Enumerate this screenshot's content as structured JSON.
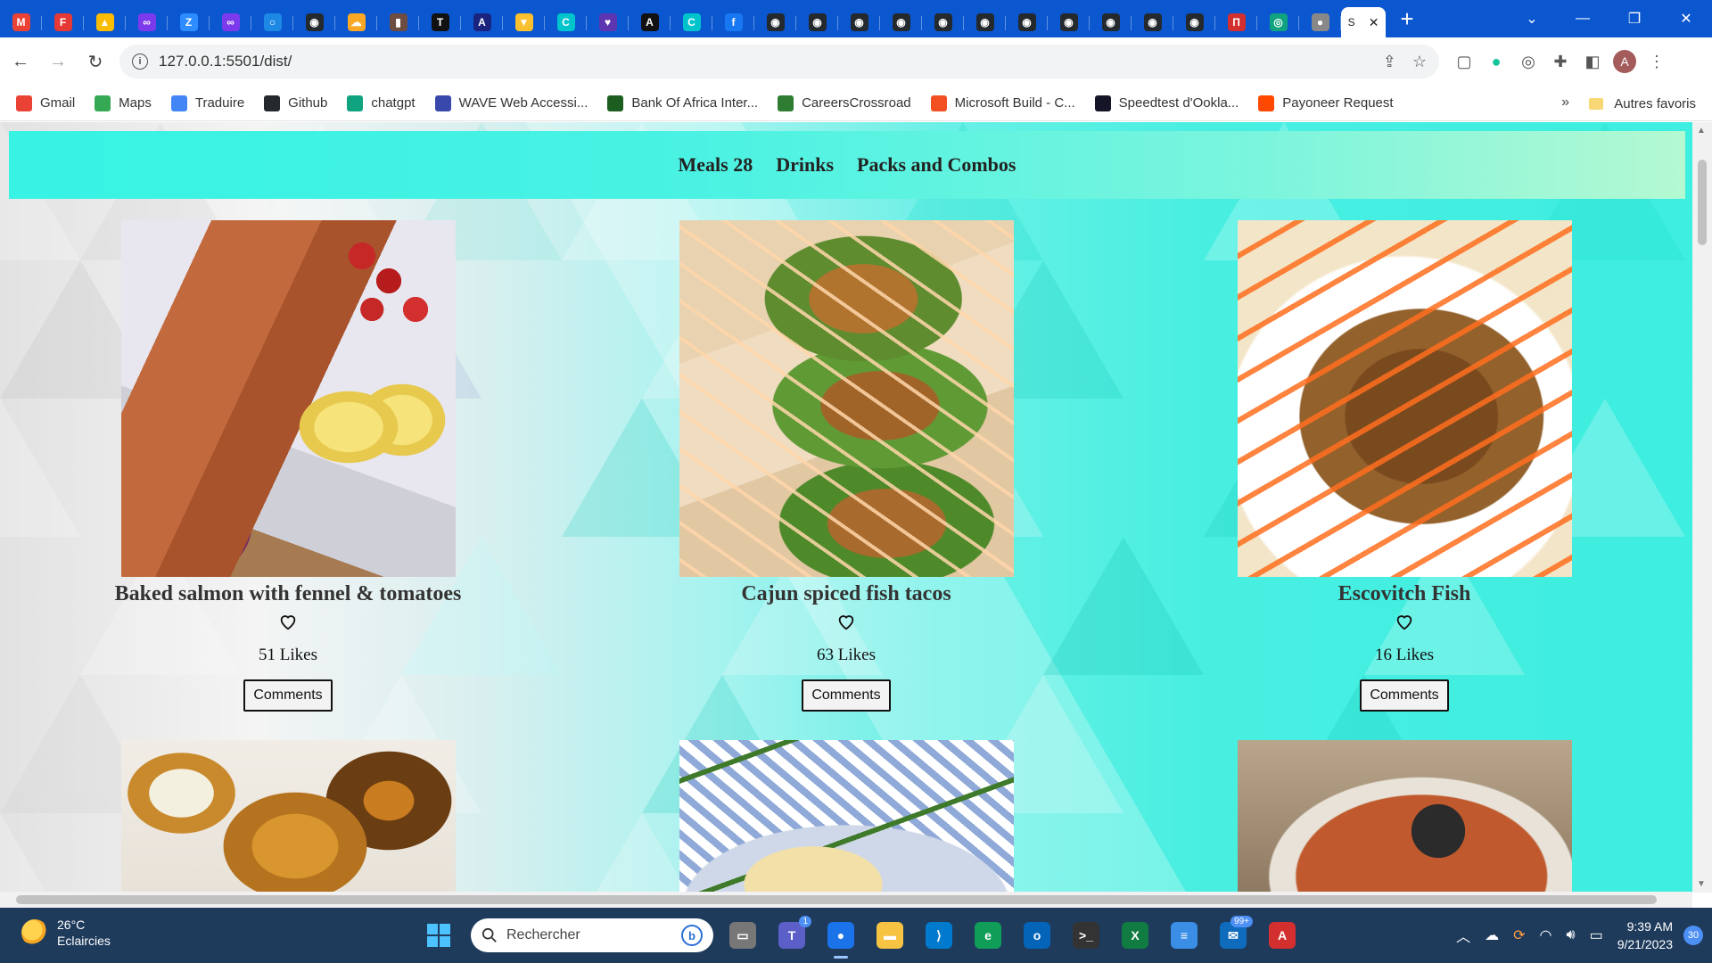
{
  "browser": {
    "tab_favicons": [
      {
        "icon": "gmail-icon",
        "color": "#ea4335",
        "glyph": "M"
      },
      {
        "icon": "app-icon",
        "color": "#e53935",
        "glyph": "F"
      },
      {
        "icon": "drive-icon",
        "color": "#fbbc04",
        "glyph": "▲"
      },
      {
        "icon": "app-icon",
        "color": "#7c3aed",
        "glyph": "∞"
      },
      {
        "icon": "zoom-icon",
        "color": "#2d8cff",
        "glyph": "Z"
      },
      {
        "icon": "app-icon",
        "color": "#7c3aed",
        "glyph": "∞"
      },
      {
        "icon": "app-icon",
        "color": "#1e88e5",
        "glyph": "○"
      },
      {
        "icon": "github-icon",
        "color": "#24292e",
        "glyph": "◉"
      },
      {
        "icon": "app-icon",
        "color": "#f9a825",
        "glyph": "☁"
      },
      {
        "icon": "app-icon",
        "color": "#6d4c41",
        "glyph": "▮"
      },
      {
        "icon": "app-icon",
        "color": "#111111",
        "glyph": "T"
      },
      {
        "icon": "app-icon",
        "color": "#1a237e",
        "glyph": "A"
      },
      {
        "icon": "app-icon",
        "color": "#fbc02d",
        "glyph": "▼"
      },
      {
        "icon": "canva-icon",
        "color": "#00c4cc",
        "glyph": "C"
      },
      {
        "icon": "app-icon",
        "color": "#5e35b1",
        "glyph": "♥"
      },
      {
        "icon": "app-icon",
        "color": "#111111",
        "glyph": "A"
      },
      {
        "icon": "canva-icon",
        "color": "#00c4cc",
        "glyph": "C"
      },
      {
        "icon": "facebook-icon",
        "color": "#1877f2",
        "glyph": "f"
      },
      {
        "icon": "github-icon",
        "color": "#24292e",
        "glyph": "◉"
      },
      {
        "icon": "github-icon",
        "color": "#24292e",
        "glyph": "◉"
      },
      {
        "icon": "github-icon",
        "color": "#24292e",
        "glyph": "◉"
      },
      {
        "icon": "github-icon",
        "color": "#24292e",
        "glyph": "◉"
      },
      {
        "icon": "github-icon",
        "color": "#24292e",
        "glyph": "◉"
      },
      {
        "icon": "github-icon",
        "color": "#24292e",
        "glyph": "◉"
      },
      {
        "icon": "github-icon",
        "color": "#24292e",
        "glyph": "◉"
      },
      {
        "icon": "github-icon",
        "color": "#24292e",
        "glyph": "◉"
      },
      {
        "icon": "github-icon",
        "color": "#24292e",
        "glyph": "◉"
      },
      {
        "icon": "github-icon",
        "color": "#24292e",
        "glyph": "◉"
      },
      {
        "icon": "github-icon",
        "color": "#24292e",
        "glyph": "◉"
      },
      {
        "icon": "app-icon",
        "color": "#d32f2f",
        "glyph": "П"
      },
      {
        "icon": "chatgpt-icon",
        "color": "#10a37f",
        "glyph": "◎"
      },
      {
        "icon": "app-icon",
        "color": "#888888",
        "glyph": "●"
      }
    ],
    "active_tab_title": "S",
    "url": "127.0.0.1:5501/dist/",
    "bookmarks": [
      {
        "label": "Gmail",
        "icon": "gmail-icon",
        "color": "#ea4335"
      },
      {
        "label": "Maps",
        "icon": "maps-icon",
        "color": "#34a853"
      },
      {
        "label": "Traduire",
        "icon": "translate-icon",
        "color": "#4285f4"
      },
      {
        "label": "Github",
        "icon": "github-icon",
        "color": "#24292e"
      },
      {
        "label": "chatgpt",
        "icon": "chatgpt-icon",
        "color": "#10a37f"
      },
      {
        "label": "WAVE Web Accessi...",
        "icon": "wave-icon",
        "color": "#3949ab"
      },
      {
        "label": "Bank Of Africa Inter...",
        "icon": "bank-icon",
        "color": "#1b5e20"
      },
      {
        "label": "CareersCrossroad",
        "icon": "careers-icon",
        "color": "#2e7d32"
      },
      {
        "label": "Microsoft Build - C...",
        "icon": "microsoft-icon",
        "color": "#f25022"
      },
      {
        "label": "Speedtest d'Ookla...",
        "icon": "speedtest-icon",
        "color": "#141526"
      },
      {
        "label": "Payoneer Request",
        "icon": "payoneer-icon",
        "color": "#ff4800"
      }
    ],
    "bookmarks_more": "»",
    "other_bookmarks": "Autres favoris",
    "avatar_letter": "A"
  },
  "page": {
    "nav": [
      {
        "label": "Meals 28"
      },
      {
        "label": "Drinks"
      },
      {
        "label": "Packs and Combos"
      }
    ],
    "meals": [
      {
        "title": "Baked salmon with fennel & tomatoes",
        "likes": "51 Likes",
        "comments": "Comments",
        "image": "salmon-photo"
      },
      {
        "title": "Cajun spiced fish tacos",
        "likes": "63 Likes",
        "comments": "Comments",
        "image": "tacos-photo"
      },
      {
        "title": "Escovitch Fish",
        "likes": "16 Likes",
        "comments": "Comments",
        "image": "fish-photo"
      }
    ],
    "next_row_images": [
      "croquettes-photo",
      "fishpie-photo",
      "seafood-soup-photo"
    ]
  },
  "taskbar": {
    "weather_temp": "26°C",
    "weather_desc": "Eclaircies",
    "search_placeholder": "Rechercher",
    "apps": [
      {
        "icon": "file-explorer-icon",
        "color": "#777777",
        "glyph": "▭"
      },
      {
        "icon": "teams-icon",
        "color": "#5b5fc7",
        "glyph": "T",
        "badge": "1"
      },
      {
        "icon": "chrome-icon",
        "color": "#1a73e8",
        "glyph": "●",
        "active": true
      },
      {
        "icon": "folder-icon",
        "color": "#f6c343",
        "glyph": "▬"
      },
      {
        "icon": "vscode-icon",
        "color": "#007acc",
        "glyph": "⟩"
      },
      {
        "icon": "edge-icon",
        "color": "#0f9d58",
        "glyph": "e"
      },
      {
        "icon": "outlook-icon",
        "color": "#0364b8",
        "glyph": "o"
      },
      {
        "icon": "terminal-icon",
        "color": "#333333",
        "glyph": ">_"
      },
      {
        "icon": "excel-icon",
        "color": "#107c41",
        "glyph": "X"
      },
      {
        "icon": "notepad-icon",
        "color": "#3a8ee6",
        "glyph": "≡"
      },
      {
        "icon": "mail-icon",
        "color": "#0f6cbd",
        "glyph": "✉",
        "badge": "99+"
      },
      {
        "icon": "acrobat-icon",
        "color": "#d32f2f",
        "glyph": "A"
      }
    ],
    "time": "9:39 AM",
    "date": "9/21/2023",
    "notifications": "30"
  }
}
